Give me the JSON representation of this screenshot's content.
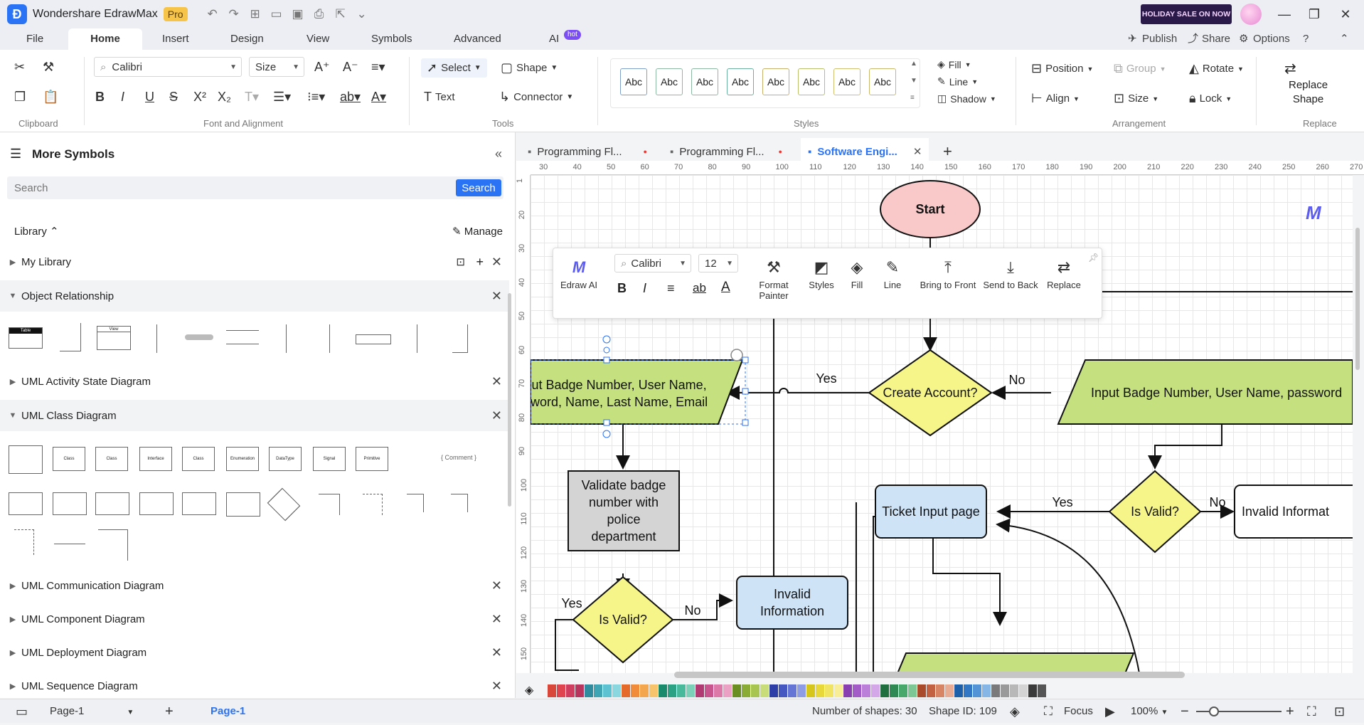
{
  "app": {
    "name": "Wondershare EdrawMax",
    "badge": "Pro",
    "sale": "HOLIDAY SALE ON NOW"
  },
  "menu": {
    "items": [
      "File",
      "Home",
      "Insert",
      "Design",
      "View",
      "Symbols",
      "Advanced",
      "AI"
    ],
    "hot": "hot",
    "right": [
      "Publish",
      "Share",
      "Options"
    ]
  },
  "ribbon": {
    "font": "Calibri",
    "size": "Size",
    "select": "Select",
    "shape": "Shape",
    "text": "Text",
    "connector": "Connector",
    "style_boxes": [
      "Abc",
      "Abc",
      "Abc",
      "Abc",
      "Abc",
      "Abc",
      "Abc",
      "Abc"
    ],
    "fill": "Fill",
    "line": "Line",
    "shadow": "Shadow",
    "position": "Position",
    "group": "Group",
    "rotate": "Rotate",
    "align": "Align",
    "lock": "Lock",
    "replace_shape": [
      "Replace",
      "Shape"
    ],
    "labels": {
      "clipboard": "Clipboard",
      "font": "Font and Alignment",
      "tools": "Tools",
      "styles": "Styles",
      "arrangement": "Arrangement",
      "replace": "Replace"
    }
  },
  "left": {
    "title": "More Symbols",
    "search_placeholder": "Search",
    "search_btn": "Search",
    "library": "Library",
    "manage": "Manage",
    "my_library": "My Library",
    "categories": [
      "Object Relationship",
      "UML Activity State Diagram",
      "UML Class Diagram",
      "UML Communication Diagram",
      "UML Component Diagram",
      "UML Deployment Diagram",
      "UML Sequence Diagram"
    ],
    "class_syms": [
      "Class",
      "Class",
      "Interface",
      "Class",
      "Enumeration",
      "DataType",
      "Signal",
      "Primitive",
      "Comment"
    ],
    "obj_syms": [
      "Table",
      "View"
    ]
  },
  "tabs": [
    "Programming Fl...",
    "Programming Fl...",
    "Software Engi..."
  ],
  "ruler_h": [
    "30",
    "40",
    "50",
    "60",
    "70",
    "80",
    "90",
    "100",
    "110",
    "120",
    "130",
    "140",
    "150",
    "160",
    "170",
    "180",
    "190",
    "200",
    "210",
    "220",
    "230",
    "240",
    "250",
    "260",
    "270"
  ],
  "ruler_v": [
    "1",
    "20",
    "30",
    "40",
    "50",
    "60",
    "70",
    "80",
    "90",
    "100",
    "110",
    "120",
    "130",
    "140",
    "150"
  ],
  "float": {
    "font": "Calibri",
    "size": "12",
    "items": [
      "Edraw AI",
      "Format\nPainter",
      "Styles",
      "Fill",
      "Line",
      "Bring to Front",
      "Send to Back",
      "Replace"
    ]
  },
  "diagram": {
    "start": "Start",
    "create_account": "Create Account?",
    "input_left": "ut Badge Number, User Name,\nword, Name, Last Name, Email",
    "input_right": "Input Badge Number, User Name, password",
    "validate": "Validate badge\nnumber with\npolice\ndepartment",
    "is_valid_1": "Is Valid?",
    "is_valid_2": "Is Valid?",
    "invalid_1": "Invalid\nInformation",
    "invalid_2": "Invalid Informat",
    "ticket": "Ticket Input page",
    "yes": "Yes",
    "no": "No"
  },
  "status": {
    "page_tab": "Page-1",
    "page_active": "Page-1",
    "shapes": "Number of shapes: 30",
    "shape_id": "Shape ID: 109",
    "focus": "Focus",
    "zoom": "100%"
  },
  "palette": [
    "#d9463a",
    "#e0454f",
    "#cf3d5f",
    "#b8365e",
    "#2f8c9f",
    "#3fa5b5",
    "#5cc2d1",
    "#8ad7e0",
    "#e56b2b",
    "#f08c3a",
    "#f3a64e",
    "#f7c46b",
    "#1a8a6c",
    "#2aa283",
    "#48b99b",
    "#7dd0b8",
    "#b13a73",
    "#c9558f",
    "#dc79a9",
    "#eaa1c3",
    "#6b8e23",
    "#8aab36",
    "#a9c551",
    "#c8dd7a",
    "#2f3fa8",
    "#4558c2",
    "#6475d6",
    "#8e9ce6",
    "#d6c51a",
    "#e8d83a",
    "#f1e463",
    "#f7ee97",
    "#8a3fb0",
    "#a35cc7",
    "#bc7fd9",
    "#d3a7e8",
    "#1f6f3f",
    "#2e8a52",
    "#48a86b",
    "#7cc794",
    "#a94a2b",
    "#c26242",
    "#d88566",
    "#e8ab93",
    "#1e5faa",
    "#3277c4",
    "#5294d6",
    "#86b6e6",
    "#7a7a7a",
    "#9a9a9a",
    "#b8b8b8",
    "#d4d4d4",
    "#3a3a3a",
    "#555555"
  ]
}
